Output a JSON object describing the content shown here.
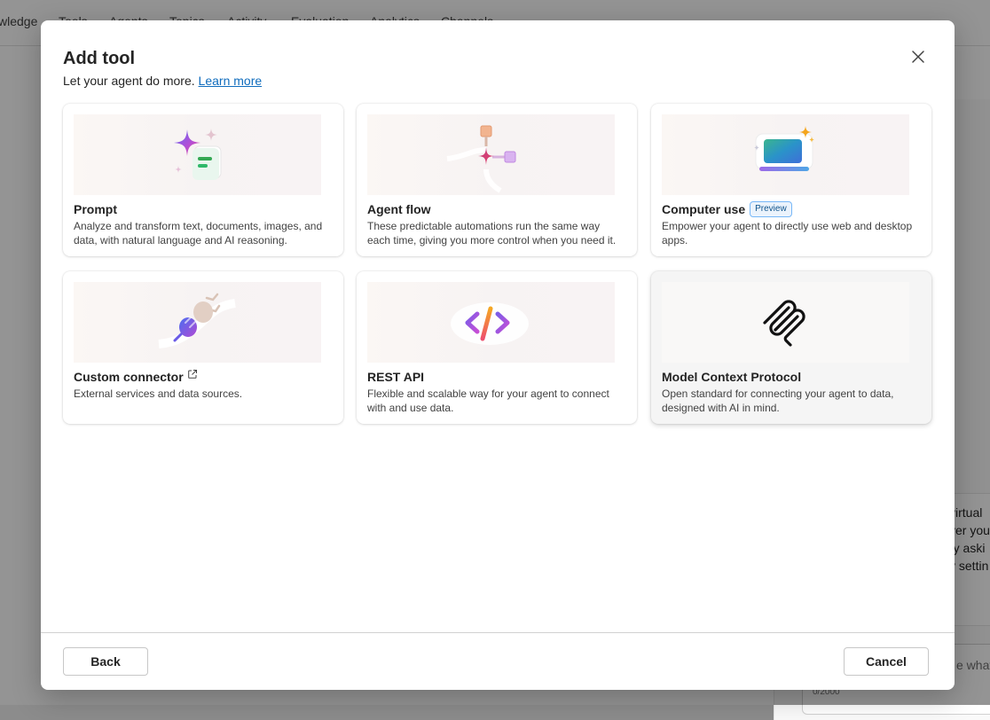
{
  "background": {
    "tabs": [
      "wledge",
      "Tools",
      "Agents",
      "Topics",
      "Activity",
      "Evaluation",
      "Analytics",
      "Channels"
    ],
    "side_lines": [
      "virtual",
      "ver you",
      "ry aski",
      "y settin"
    ],
    "input_placeholder": "e what",
    "char_count": "0/2000"
  },
  "dialog": {
    "title": "Add tool",
    "subtitle": "Let your agent do more.",
    "learn_more": "Learn more",
    "close_icon": "dismiss-icon",
    "cards": [
      {
        "title": "Prompt",
        "description": "Analyze and transform text, documents, images, and data, with natural language and AI reasoning.",
        "icon": "sparkle-prompt-illustration"
      },
      {
        "title": "Agent flow",
        "description": "These predictable automations run the same way each time, giving you more control when you need it.",
        "icon": "flow-nodes-illustration"
      },
      {
        "title": "Computer use",
        "badge": "Preview",
        "description": "Empower your agent to directly use web and desktop apps.",
        "icon": "laptop-sparkle-illustration"
      },
      {
        "title": "Custom connector",
        "external_icon": "open-external-icon",
        "description": "External services and data sources.",
        "icon": "plug-illustration"
      },
      {
        "title": "REST API",
        "description": "Flexible and scalable way for your agent to connect with and use data.",
        "icon": "code-brackets-illustration"
      },
      {
        "title": "Model Context Protocol",
        "description": "Open standard for connecting your agent to data, designed with AI in mind.",
        "icon": "mcp-logo",
        "selected": true
      }
    ],
    "back_label": "Back",
    "cancel_label": "Cancel"
  }
}
